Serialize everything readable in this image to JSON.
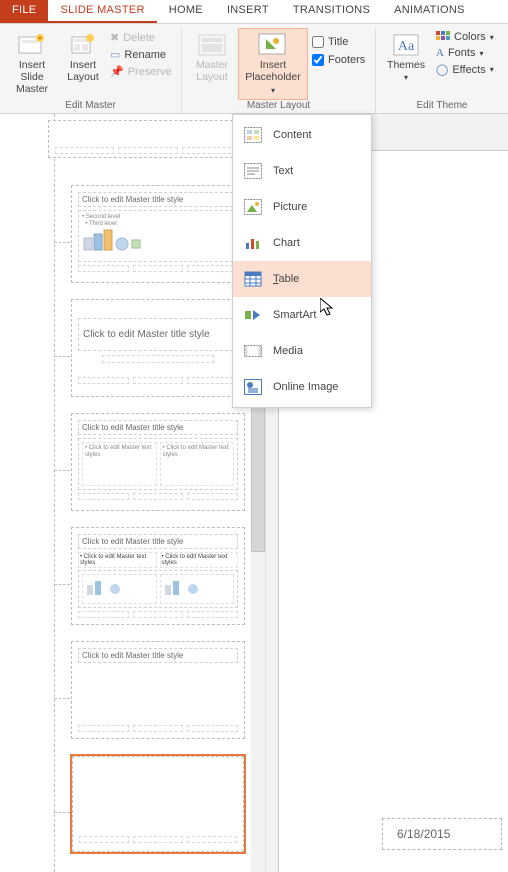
{
  "tabs": {
    "file": "FILE",
    "slide_master": "SLIDE MASTER",
    "home": "HOME",
    "insert": "INSERT",
    "transitions": "TRANSITIONS",
    "animations": "ANIMATIONS"
  },
  "ribbon": {
    "edit_master": {
      "label": "Edit Master",
      "insert_slide_master": "Insert Slide Master",
      "insert_layout": "Insert Layout",
      "delete": "Delete",
      "rename": "Rename",
      "preserve": "Preserve"
    },
    "master_layout": {
      "master_layout": "Master Layout",
      "insert_placeholder": "Insert Placeholder",
      "title": "Title",
      "footers": "Footers"
    },
    "edit_theme": {
      "label": "Edit Theme",
      "themes": "Themes",
      "colors": "Colors",
      "fonts": "Fonts",
      "effects": "Effects"
    }
  },
  "dropdown": {
    "content": "Content",
    "text": "Text",
    "picture": "Picture",
    "chart": "Chart",
    "table": "Table",
    "smartart": "SmartArt",
    "media": "Media",
    "online_image": "Online Image"
  },
  "thumbs": {
    "title_text": "Click to edit Master title style",
    "text_text": "• Click to edit Master text styles"
  },
  "canvas": {
    "date": "6/18/2015"
  }
}
